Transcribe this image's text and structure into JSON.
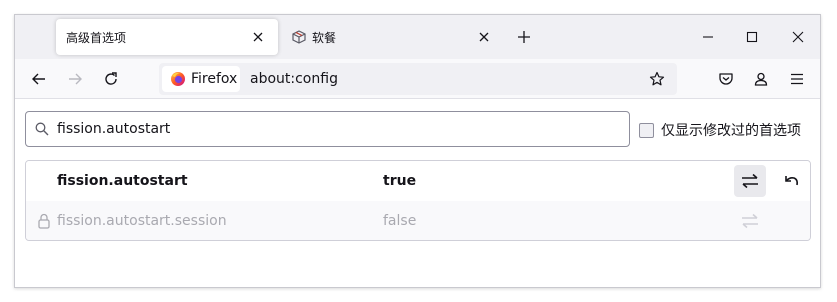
{
  "tabs": [
    {
      "title": "高级首选项",
      "active": true
    },
    {
      "title": "软餐",
      "active": false,
      "icon": "package-icon"
    }
  ],
  "nav": {
    "identity_label": "Firefox",
    "url": "about:config"
  },
  "search": {
    "value": "fission.autostart"
  },
  "filter": {
    "label": "仅显示修改过的首选项",
    "checked": false
  },
  "prefs": [
    {
      "name": "fission.autostart",
      "value": "true",
      "locked": false,
      "modified": true
    },
    {
      "name": "fission.autostart.session",
      "value": "false",
      "locked": true,
      "modified": false
    }
  ],
  "colors": {
    "accent": "#0061e0",
    "tabstrip_bg": "#f0f0f4",
    "toolbar_bg": "#f9f9fb",
    "text": "#15141a",
    "disabled_text": "#a9a9b0"
  }
}
